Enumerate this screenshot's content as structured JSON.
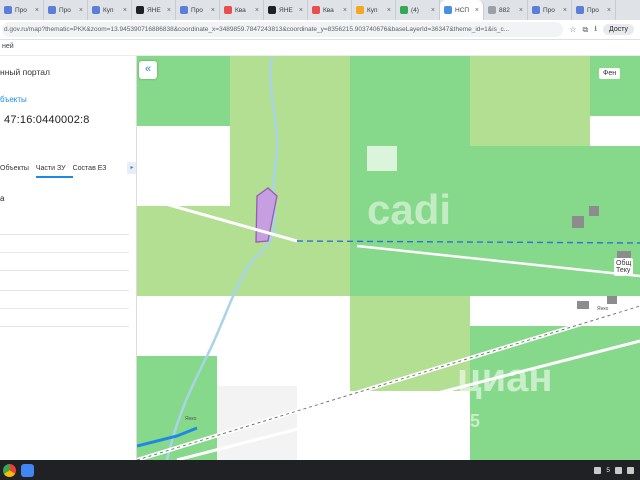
{
  "browser": {
    "tabs": [
      {
        "label": "Про",
        "favicon_color": "#5b7fd8",
        "active": false
      },
      {
        "label": "Про",
        "favicon_color": "#5b7fd8",
        "active": false
      },
      {
        "label": "Куп",
        "favicon_color": "#5b7fd8",
        "active": false
      },
      {
        "label": "ЯНЕ",
        "favicon_color": "#202124",
        "active": false
      },
      {
        "label": "Про",
        "favicon_color": "#5b7fd8",
        "active": false
      },
      {
        "label": "Ква",
        "favicon_color": "#e94e4e",
        "active": false
      },
      {
        "label": "ЯНЕ",
        "favicon_color": "#202124",
        "active": false
      },
      {
        "label": "Ква",
        "favicon_color": "#e94e4e",
        "active": false
      },
      {
        "label": "Куп",
        "favicon_color": "#f5a623",
        "active": false
      },
      {
        "label": "(4) ",
        "favicon_color": "#34a853",
        "active": false
      },
      {
        "label": "НСП",
        "favicon_color": "#4a90e2",
        "active": true
      },
      {
        "label": "882",
        "favicon_color": "#9aa0a6",
        "active": false
      },
      {
        "label": "Про",
        "favicon_color": "#5b7fd8",
        "active": false
      },
      {
        "label": "Про",
        "favicon_color": "#5b7fd8",
        "active": false
      }
    ],
    "url": "d.gov.ru/map?thematic=PKK&zoom=13.945390716886838&coordinate_x=3489859.7847243813&coordinate_y=8356215.903740676&baseLayerId=36347&theme_id=1&is_c...",
    "profile_label": "Досту",
    "bookmarks_label": "ней"
  },
  "sidebar": {
    "title": "нный портал",
    "objects_link": "бъекты",
    "cadastral_number": "47:16:0440002:8",
    "tabs": [
      {
        "label": "Объекты",
        "active": false
      },
      {
        "label": "Части ЗУ",
        "active": true
      },
      {
        "label": "Состав ЕЗ",
        "active": false
      }
    ],
    "section_heading": "а"
  },
  "map": {
    "collapse_icon": "«",
    "label_top": "Фен",
    "label_right_1": "Общ",
    "label_right_2": "Теку",
    "watermark_1": "cadi",
    "watermark_2": "циан",
    "watermark_3": "ID 325",
    "tiny_labels": [
      "Янко",
      "Янко"
    ]
  },
  "taskbar": {
    "tray_text": "5"
  }
}
